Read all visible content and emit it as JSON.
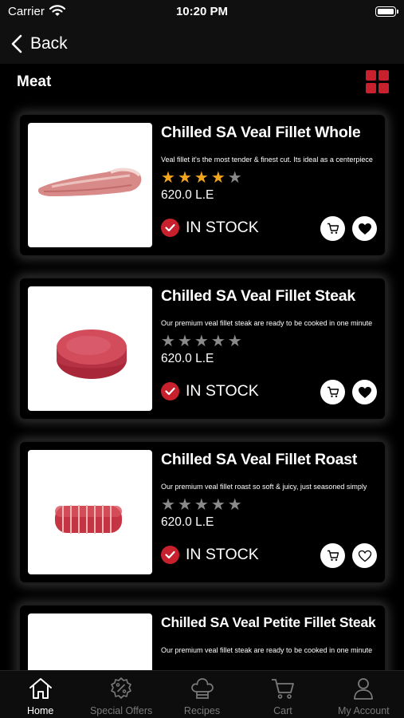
{
  "status_bar": {
    "carrier": "Carrier",
    "time": "10:20 PM"
  },
  "nav": {
    "back_label": "Back"
  },
  "section": {
    "title": "Meat"
  },
  "colors": {
    "accent": "#c8202d",
    "star_on": "#f2a51e",
    "star_off": "#8a8a8a",
    "background": "#000000"
  },
  "products": [
    {
      "name": "Chilled SA Veal Fillet Whole",
      "description": "Veal fillet it's the most tender & finest cut. Its ideal as a centerpiece",
      "rating": 4,
      "price": "620.0 L.E",
      "stock": "IN STOCK",
      "favorited": true
    },
    {
      "name": "Chilled SA Veal Fillet Steak",
      "description": "Our premium veal fillet steak are ready to be cooked in one minute",
      "rating": 0,
      "price": "620.0 L.E",
      "stock": "IN STOCK",
      "favorited": true
    },
    {
      "name": "Chilled SA Veal Fillet Roast",
      "description": "Our premium veal fillet roast so soft & juicy, just seasoned simply",
      "rating": 0,
      "price": "620.0 L.E",
      "stock": "IN STOCK",
      "favorited": false
    },
    {
      "name": "Chilled SA Veal Petite Fillet Steak",
      "description": "Our premium veal fillet steak are ready to be cooked in one minute",
      "rating": 0,
      "price": "",
      "stock": "",
      "favorited": false
    }
  ],
  "tabs": [
    {
      "label": "Home",
      "icon": "home-icon",
      "active": true
    },
    {
      "label": "Special Offers",
      "icon": "offers-icon",
      "active": false
    },
    {
      "label": "Recipes",
      "icon": "chef-hat-icon",
      "active": false
    },
    {
      "label": "Cart",
      "icon": "cart-icon",
      "active": false
    },
    {
      "label": "My Account",
      "icon": "account-icon",
      "active": false
    }
  ]
}
